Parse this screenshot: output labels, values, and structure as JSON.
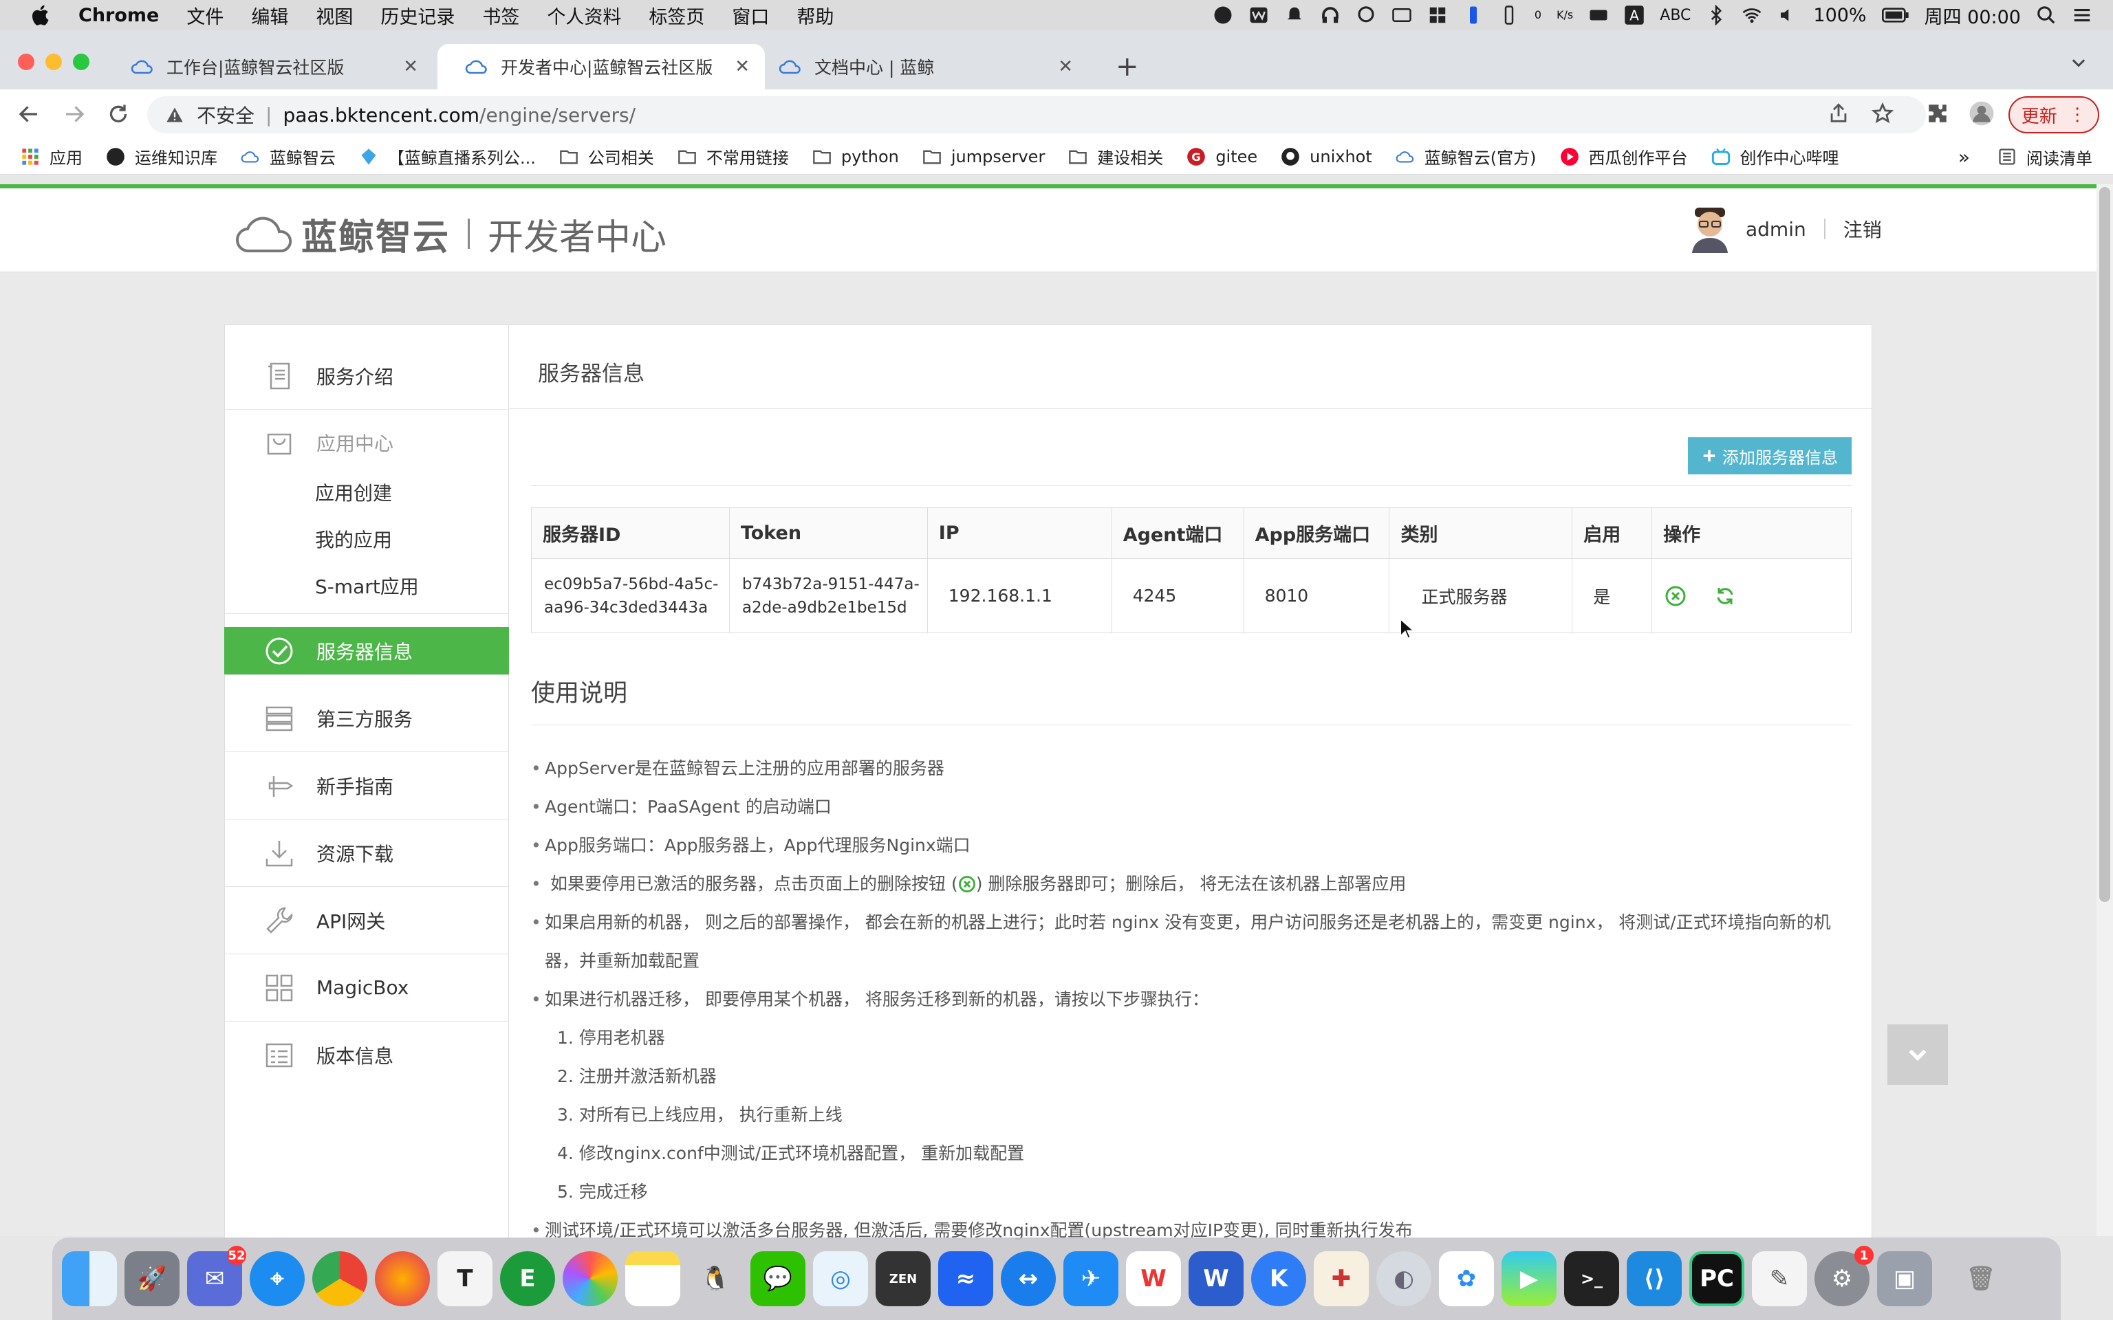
{
  "menubar": {
    "app_name": "Chrome",
    "items": [
      "文件",
      "编辑",
      "视图",
      "历史记录",
      "书签",
      "个人资料",
      "标签页",
      "窗口",
      "帮助"
    ],
    "battery": "100%",
    "clock": "周四 00:00",
    "input_method": "ABC",
    "net_speed_up": "0",
    "net_speed_down": "0",
    "net_unit": "K/s"
  },
  "tabs": [
    {
      "title": "工作台|蓝鲸智云社区版",
      "active": false
    },
    {
      "title": "开发者中心|蓝鲸智云社区版",
      "active": true
    },
    {
      "title": "文档中心 | 蓝鲸",
      "active": false
    }
  ],
  "omnibox": {
    "security": "不安全",
    "host": "paas.bktencent.com",
    "path": "/engine/servers/"
  },
  "update_label": "更新",
  "bookmarks": {
    "items": [
      "应用",
      "运维知识库",
      "蓝鲸智云",
      "【蓝鲸直播系列公...",
      "公司相关",
      "不常用链接",
      "python",
      "jumpserver",
      "建设相关",
      "gitee",
      "unixhot",
      "蓝鲸智云(官方)",
      "西瓜创作平台",
      "创作中心哔哩"
    ],
    "overflow": "»",
    "reading_list": "阅读清单"
  },
  "header": {
    "brand": "蓝鲸智云",
    "subtitle": "开发者中心",
    "user": "admin",
    "logout": "注销"
  },
  "sidebar": {
    "items": [
      {
        "label": "服务介绍",
        "icon": "document-icon"
      },
      {
        "label": "应用中心",
        "icon": "shopping-bag-icon"
      },
      {
        "label": "服务器信息",
        "icon": "check-circle-icon"
      },
      {
        "label": "第三方服务",
        "icon": "server-stack-icon"
      },
      {
        "label": "新手指南",
        "icon": "guide-icon"
      },
      {
        "label": "资源下载",
        "icon": "download-icon"
      },
      {
        "label": "API网关",
        "icon": "wrench-icon"
      },
      {
        "label": "MagicBox",
        "icon": "grid-icon"
      },
      {
        "label": "版本信息",
        "icon": "version-icon"
      }
    ],
    "app_center_children": [
      "应用创建",
      "我的应用",
      "S-mart应用"
    ]
  },
  "content": {
    "title": "服务器信息",
    "add_button": "添加服务器信息",
    "table": {
      "headers": [
        "服务器ID",
        "Token",
        "IP",
        "Agent端口",
        "App服务端口",
        "类别",
        "启用",
        "操作"
      ],
      "rows": [
        {
          "id_line1": "ec09b5a7-56bd-4a5c-",
          "id_line2": "aa96-34c3ded3443a",
          "token_line1": "b743b72a-9151-447a-",
          "token_line2": "a2de-a9db2e1be15d",
          "ip": "192.168.1.1",
          "agent_port": "4245",
          "app_port": "8010",
          "category": "正式服务器",
          "enabled": "是"
        }
      ]
    },
    "usage_title": "使用说明",
    "usage": {
      "l1": "AppServer是在蓝鲸智云上注册的应用部署的服务器",
      "l2": "Agent端口：PaaSAgent 的启动端口",
      "l3": "App服务端口：App服务器上，App代理服务Nginx端口",
      "l4a": "如果要停用已激活的服务器，点击页面上的删除按钮 (",
      "l4b": ") 删除服务器即可；删除后， 将无法在该机器上部署应用",
      "l5": "如果启用新的机器， 则之后的部署操作， 都会在新的机器上进行；此时若 nginx 没有变更，用户访问服务还是老机器上的，需变更 nginx， 将测试/正式环境指向新的机器，并重新加载配置",
      "l6": "如果进行机器迁移， 即要停用某个机器， 将服务迁移到新的机器，请按以下步骤执行：",
      "steps": [
        "1. 停用老机器",
        "2. 注册并激活新机器",
        "3. 对所有已上线应用， 执行重新上线",
        "4. 修改nginx.conf中测试/正式环境机器配置， 重新加载配置",
        "5. 完成迁移"
      ],
      "l7": "测试环境/正式环境可以激活多台服务器, 但激活后, 需要修改nginx配置(upstream对应IP变更), 同时重新执行发布"
    }
  },
  "dock": {
    "mail_badge": "52",
    "settings_badge": "1"
  }
}
